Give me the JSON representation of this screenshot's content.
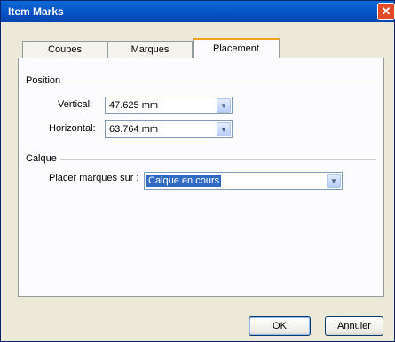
{
  "window": {
    "title": "Item Marks",
    "close_glyph": "✕"
  },
  "tabs": [
    {
      "label": "Coupes"
    },
    {
      "label": "Marques"
    },
    {
      "label": "Placement"
    }
  ],
  "position": {
    "section_label": "Position",
    "vertical": {
      "label": "Vertical:",
      "value": "47.625 mm"
    },
    "horizontal": {
      "label": "Horizontal:",
      "value": "63.764 mm"
    }
  },
  "calque": {
    "section_label": "Calque",
    "placer": {
      "label": "Placer marques sur :",
      "value": "Calque en cours"
    }
  },
  "buttons": {
    "ok": "OK",
    "annuler": "Annuler"
  },
  "icons": {
    "close": "close-icon",
    "dropdown": "chevron-down-icon"
  },
  "colors": {
    "titlebar": "#0653c6",
    "active_tab_accent": "#f2a21f",
    "selection": "#316ac5"
  }
}
